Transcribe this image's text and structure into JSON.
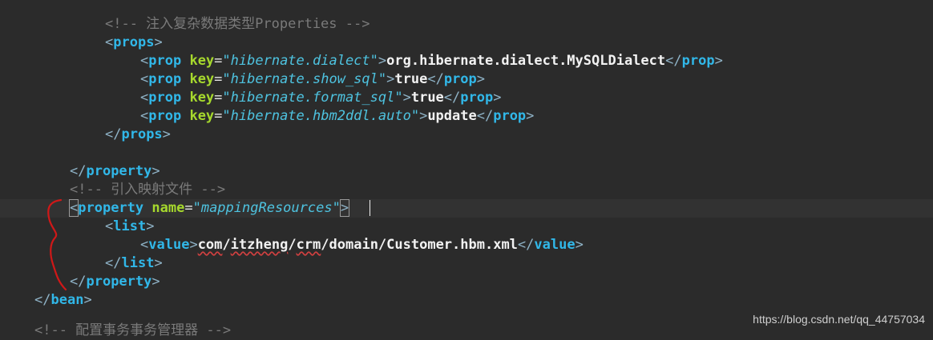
{
  "editor": {
    "line1": {
      "comment": "<!-- 注入复杂数据类型Properties -->"
    },
    "line2": {
      "tag": "props"
    },
    "line3": {
      "tag": "prop",
      "attr": "key",
      "value": "\"hibernate.dialect\"",
      "text": "org.hibernate.dialect.MySQLDialect"
    },
    "line4": {
      "tag": "prop",
      "attr": "key",
      "value": "\"hibernate.show_sql\"",
      "text": "true"
    },
    "line5": {
      "tag": "prop",
      "attr": "key",
      "value": "\"hibernate.format_sql\"",
      "text": "true"
    },
    "line6": {
      "tag": "prop",
      "attr": "key",
      "value": "\"hibernate.hbm2ddl.auto\"",
      "text": "update"
    },
    "line7": {
      "tag": "props"
    },
    "line9": {
      "tag": "property"
    },
    "line10": {
      "comment": "<!-- 引入映射文件 -->"
    },
    "line11": {
      "tag": "property",
      "attr": "name",
      "value": "\"mappingResources\""
    },
    "line12": {
      "tag": "list"
    },
    "line13": {
      "tag": "value",
      "text_parts": [
        "com",
        "/",
        "itzheng",
        "/",
        "crm",
        "/domain/Customer.hbm.xml"
      ]
    },
    "line14": {
      "tag": "list"
    },
    "line15": {
      "tag": "property"
    },
    "line16": {
      "tag": "bean"
    },
    "line17": {
      "comment": "<!-- 配置事务事务管理器 -->"
    }
  },
  "watermark": "https://blog.csdn.net/qq_44757034",
  "colors": {
    "background": "#2b2b2b",
    "tag": "#31b7e8",
    "attribute": "#a6d82d",
    "attribute_value": "#4ec3e0",
    "comment": "#7a7a7a",
    "annotation": "#d01818"
  }
}
